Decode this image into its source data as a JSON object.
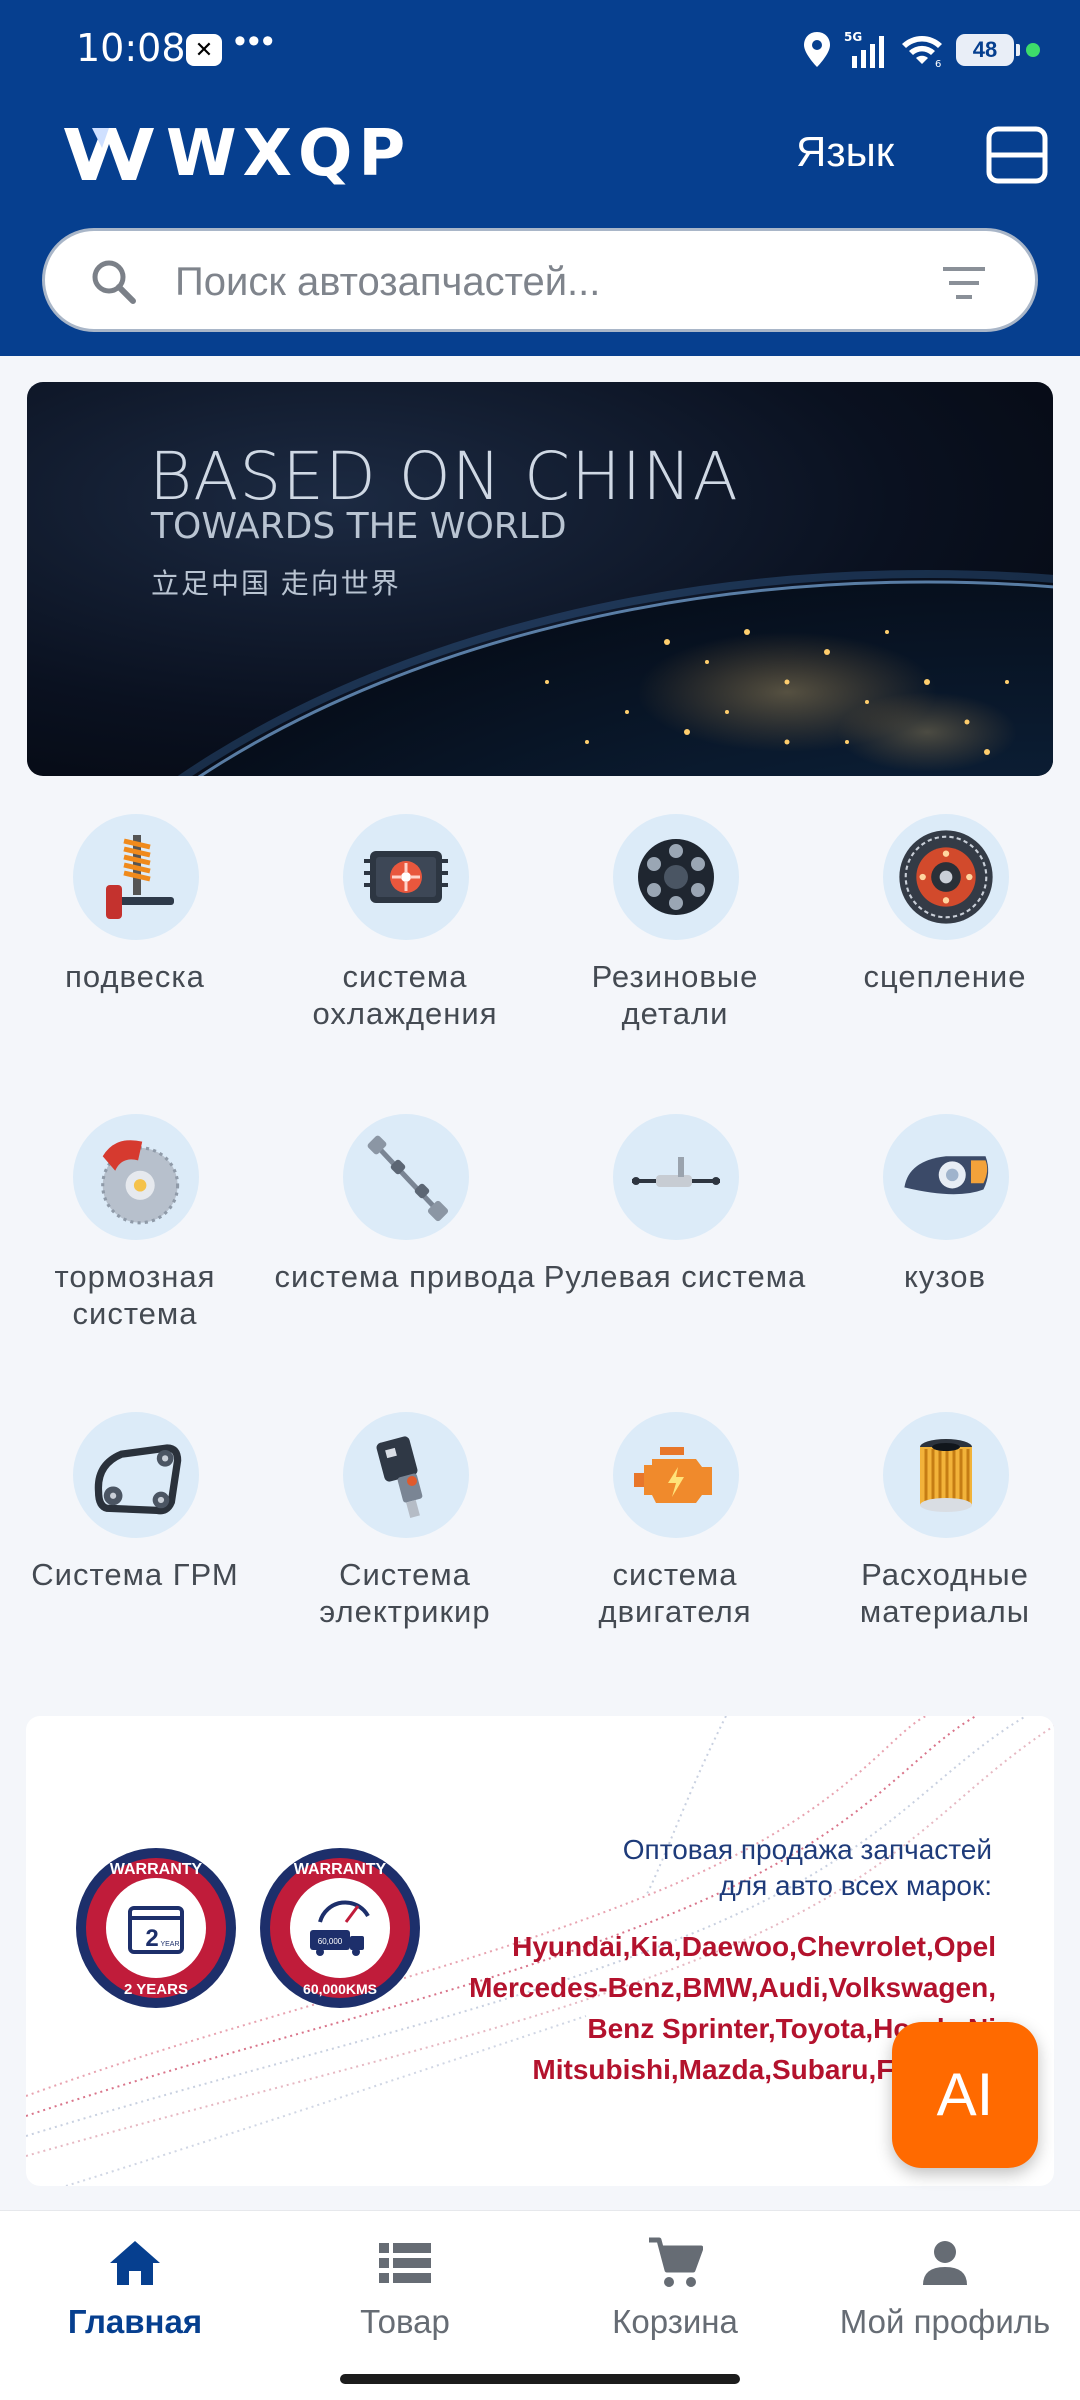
{
  "status_bar": {
    "time": "10:08",
    "app_icon": "capcut-icon",
    "more": "•••",
    "network": "5G",
    "battery": "48"
  },
  "header": {
    "brand": "WXQP",
    "language_label": "Язык",
    "menu_icon": "menu-icon"
  },
  "search": {
    "placeholder": "Поиск автозапчастей..."
  },
  "banner": {
    "line1": "BASED ON CHINA",
    "line2": "TOWARDS THE WORLD",
    "line3": "立足中国 走向世界"
  },
  "categories": [
    {
      "label": "подвеска",
      "icon": "suspension-icon"
    },
    {
      "label": "система охлаждения",
      "icon": "radiator-icon"
    },
    {
      "label": "Резиновые детали",
      "icon": "rubber-coupling-icon"
    },
    {
      "label": "сцепление",
      "icon": "clutch-icon"
    },
    {
      "label": "тормозная система",
      "icon": "brake-icon"
    },
    {
      "label": "система привода",
      "icon": "drive-shaft-icon"
    },
    {
      "label": "Рулевая система",
      "icon": "steering-rack-icon"
    },
    {
      "label": "кузов",
      "icon": "headlight-icon"
    },
    {
      "label": "Система ГРМ",
      "icon": "timing-belt-icon"
    },
    {
      "label": "Система электрикир",
      "icon": "ignition-coil-icon"
    },
    {
      "label": "система двигателя",
      "icon": "engine-icon"
    },
    {
      "label": "Расходные материалы",
      "icon": "oil-filter-icon"
    }
  ],
  "promo": {
    "badge1": {
      "top": "WARRANTY",
      "value": "2",
      "value_small": "YEAR",
      "bottom": "2 YEARS"
    },
    "badge2": {
      "top": "WARRANTY",
      "value": "60,000",
      "bottom": "60,000KMS"
    },
    "title_line1": "Оптовая продажа запчастей",
    "title_line2": "для авто всех марок:",
    "brands_line1": "Hyundai,Kia,Daewoo,Chevrolet,Opel",
    "brands_line2": "Mercedes-Benz,BMW,Audi,Volkswagen,",
    "brands_line3": "Benz Sprinter,Toyota,Honda,Ni",
    "brands_line4": "Mitsubishi,Mazda,Subaru,Ford,Lad"
  },
  "ai_button": {
    "label": "AI"
  },
  "bottom_nav": [
    {
      "label": "Главная",
      "icon": "home-icon",
      "active": true
    },
    {
      "label": "Товар",
      "icon": "list-icon",
      "active": false
    },
    {
      "label": "Корзина",
      "icon": "cart-icon",
      "active": false
    },
    {
      "label": "Мой профиль",
      "icon": "profile-icon",
      "active": false
    }
  ],
  "colors": {
    "header_bg": "#063f8f",
    "accent_orange": "#ff6a00",
    "brand_red": "#b3122d",
    "nav_active": "#063f8f"
  }
}
